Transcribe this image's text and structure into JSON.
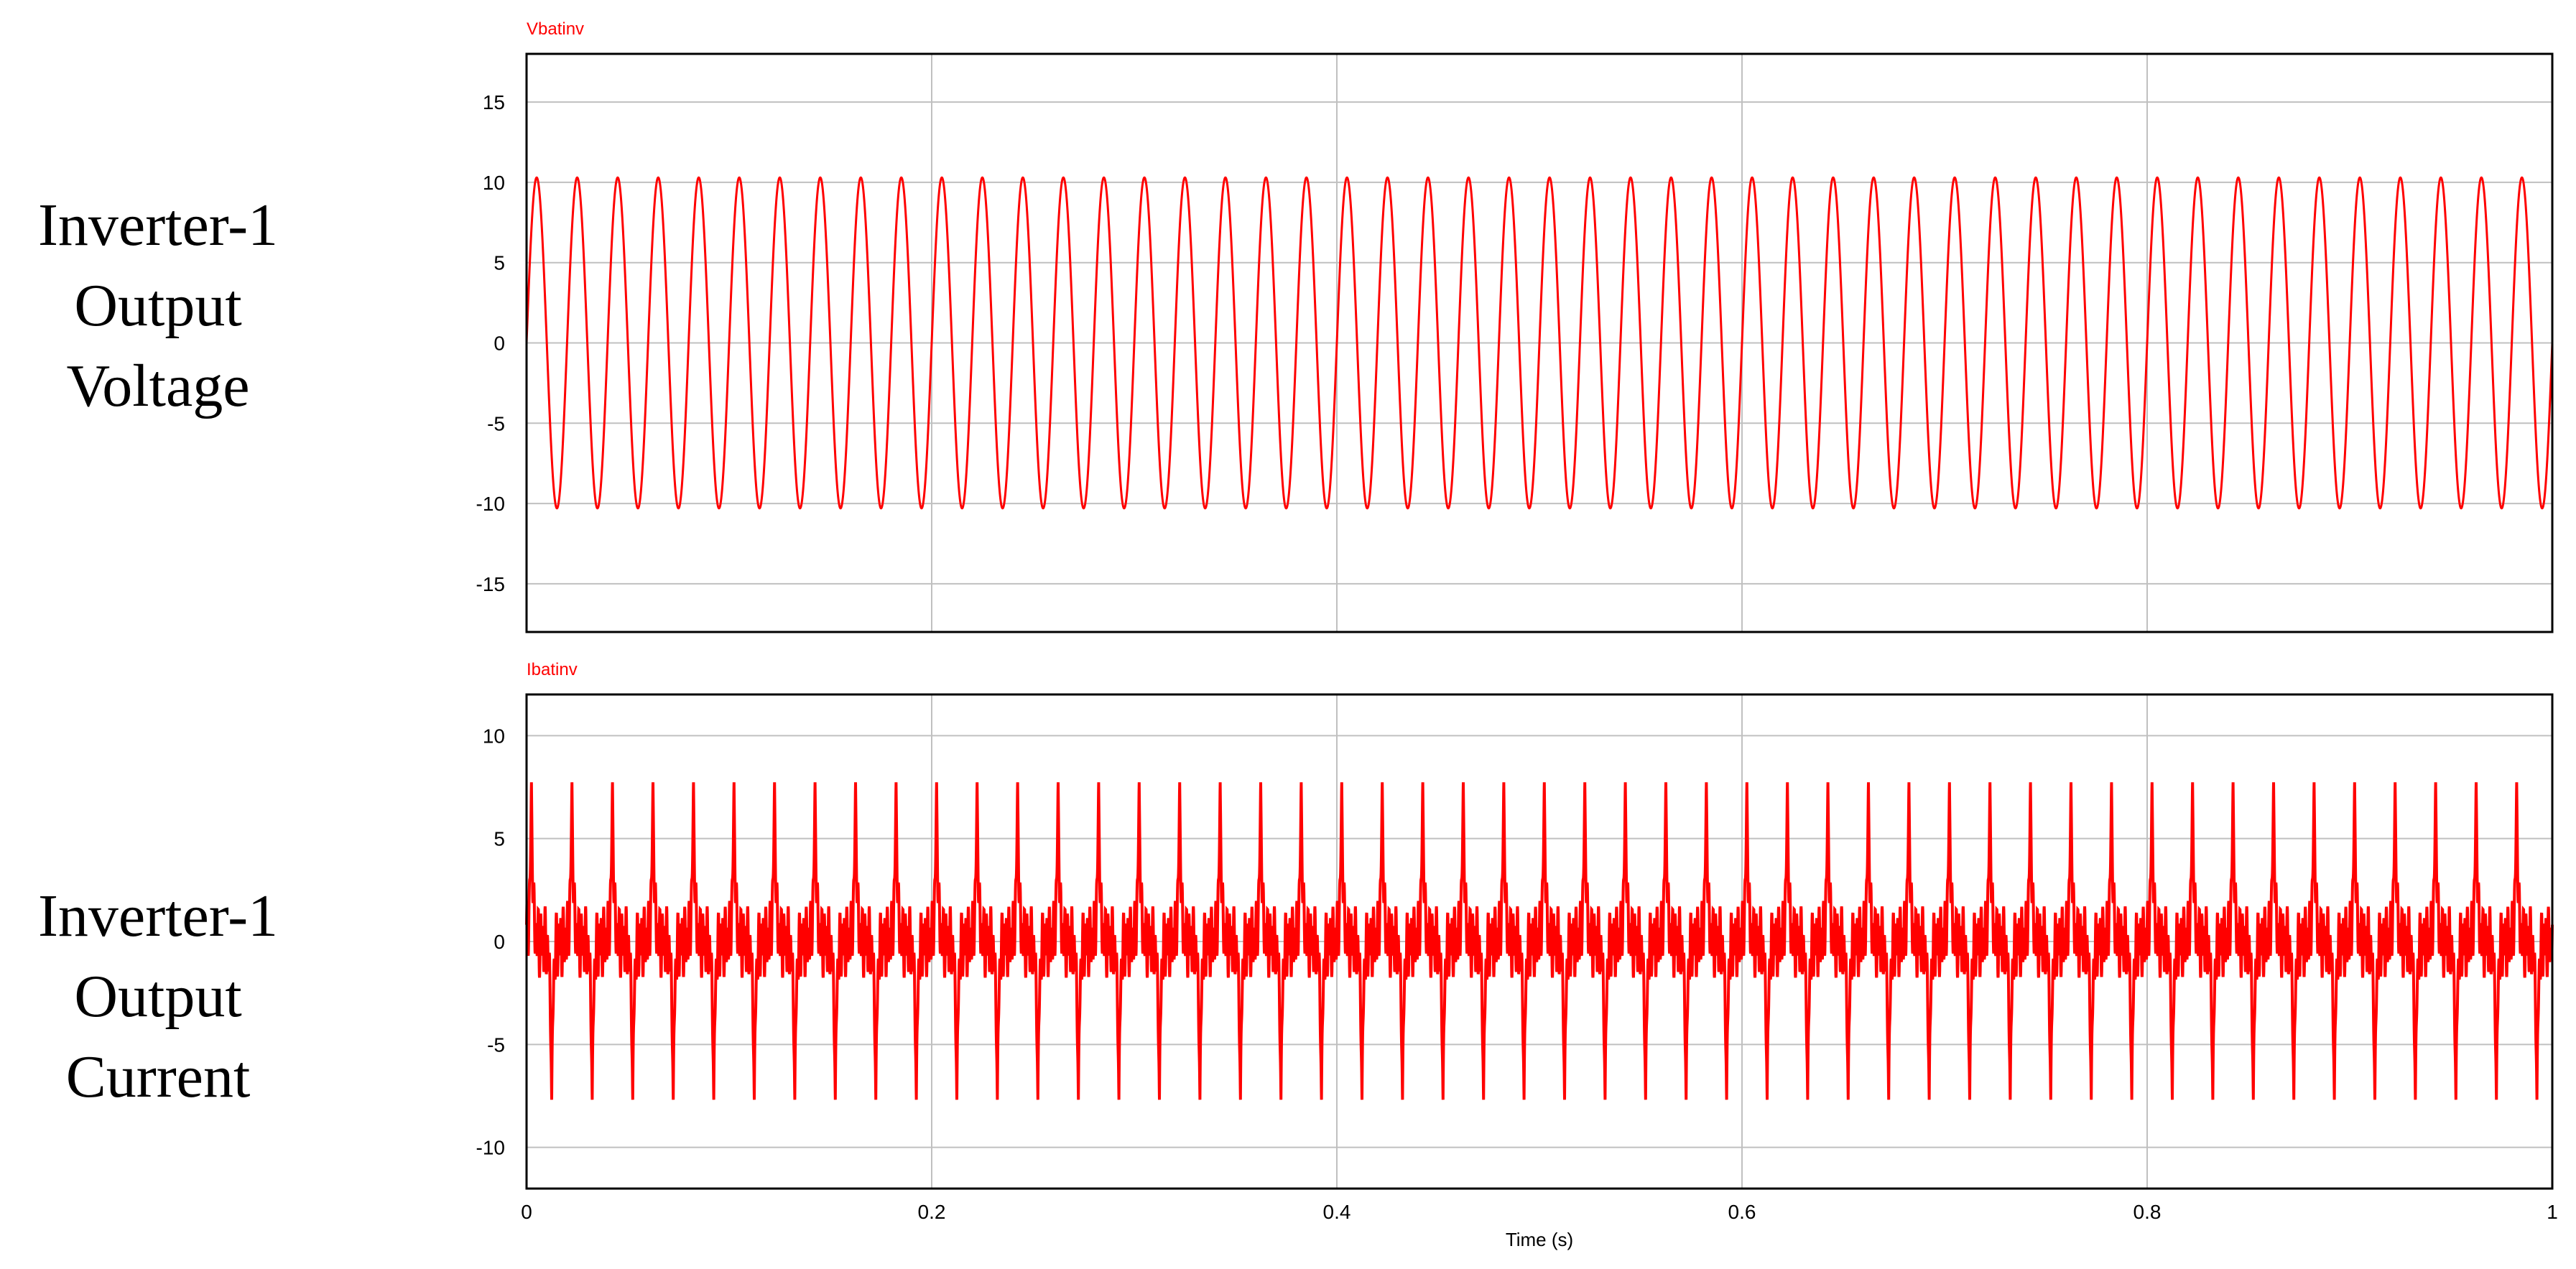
{
  "labels": {
    "voltage": [
      "Inverter-1",
      "Output",
      "Voltage"
    ],
    "current": [
      "Inverter-1",
      "Output",
      "Current"
    ]
  },
  "colors": {
    "series": "#ff0000",
    "grid": "#c0c0c0",
    "frame": "#000000",
    "background": "#ffffff"
  },
  "chart_data": [
    {
      "type": "line",
      "series_title": "Vbatinv",
      "ylim": [
        -18,
        18
      ],
      "yticks": [
        15,
        10,
        5,
        0,
        -5,
        -10,
        -15
      ],
      "xlim": [
        0,
        1
      ],
      "xticks": [],
      "xlabel": "",
      "grid": true,
      "waveform": {
        "shape": "sine",
        "frequency_hz": 50,
        "amplitude": 10.3,
        "duration_s": 1.0
      },
      "series": [
        {
          "name": "Vbatinv",
          "color": "#ff0000"
        }
      ]
    },
    {
      "type": "line",
      "series_title": "Ibatinv",
      "ylim": [
        -12,
        12
      ],
      "yticks": [
        10,
        5,
        0,
        -5,
        -10
      ],
      "xlim": [
        0,
        1
      ],
      "xticks": [
        "0",
        "0.2",
        "0.4",
        "0.6",
        "0.8",
        "1"
      ],
      "xlabel": "Time (s)",
      "grid": true,
      "waveform": {
        "shape": "peaky-distorted",
        "frequency_hz": 50,
        "peak": 7.9,
        "ripple": 1.2,
        "duration_s": 1.0
      },
      "series": [
        {
          "name": "Ibatinv",
          "color": "#ff0000"
        }
      ]
    }
  ]
}
